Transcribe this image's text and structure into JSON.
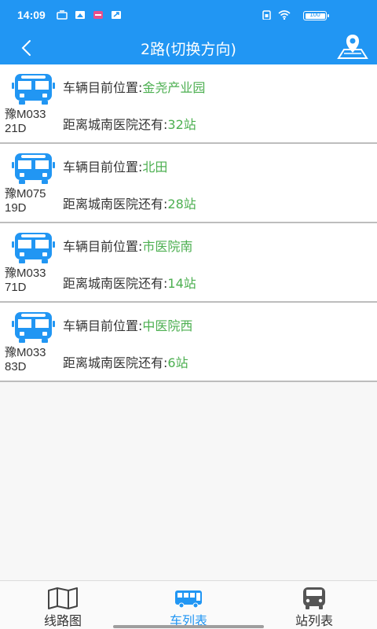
{
  "status_bar": {
    "time": "14:09",
    "battery_text": "100",
    "battery_level": 1.0,
    "icons": [
      "sim-icon",
      "image-icon",
      "app-notification-icon",
      "send-icon",
      "sim-card-icon",
      "wifi-icon",
      "battery-icon"
    ]
  },
  "header": {
    "title": "2路(切换方向)",
    "back_icon": "chevron-left-icon",
    "map_icon": "map-pin-icon"
  },
  "buses": [
    {
      "plate": "豫M03321D",
      "plate_line1": "豫M033",
      "plate_line2": "21D",
      "position_label": "车辆目前位置:",
      "position_value": "金尧产业园",
      "distance_label": "距离城南医院还有:",
      "distance_value": "32站"
    },
    {
      "plate": "豫M07519D",
      "plate_line1": "豫M075",
      "plate_line2": "19D",
      "position_label": "车辆目前位置:",
      "position_value": "北田",
      "distance_label": "距离城南医院还有:",
      "distance_value": "28站"
    },
    {
      "plate": "豫M03371D",
      "plate_line1": "豫M033",
      "plate_line2": "71D",
      "position_label": "车辆目前位置:",
      "position_value": "市医院南",
      "distance_label": "距离城南医院还有:",
      "distance_value": "14站"
    },
    {
      "plate": "豫M03383D",
      "plate_line1": "豫M033",
      "plate_line2": "83D",
      "position_label": "车辆目前位置:",
      "position_value": "中医院西",
      "distance_label": "距离城南医院还有:",
      "distance_value": "6站"
    }
  ],
  "bottom_nav": {
    "items": [
      {
        "label": "线路图",
        "icon": "map-icon",
        "active": false
      },
      {
        "label": "车列表",
        "icon": "bus-icon",
        "active": true
      },
      {
        "label": "站列表",
        "icon": "bus-stop-icon",
        "active": false
      }
    ]
  },
  "colors": {
    "primary": "#2196f3",
    "accent_green": "#4caf50",
    "text": "#333333"
  }
}
